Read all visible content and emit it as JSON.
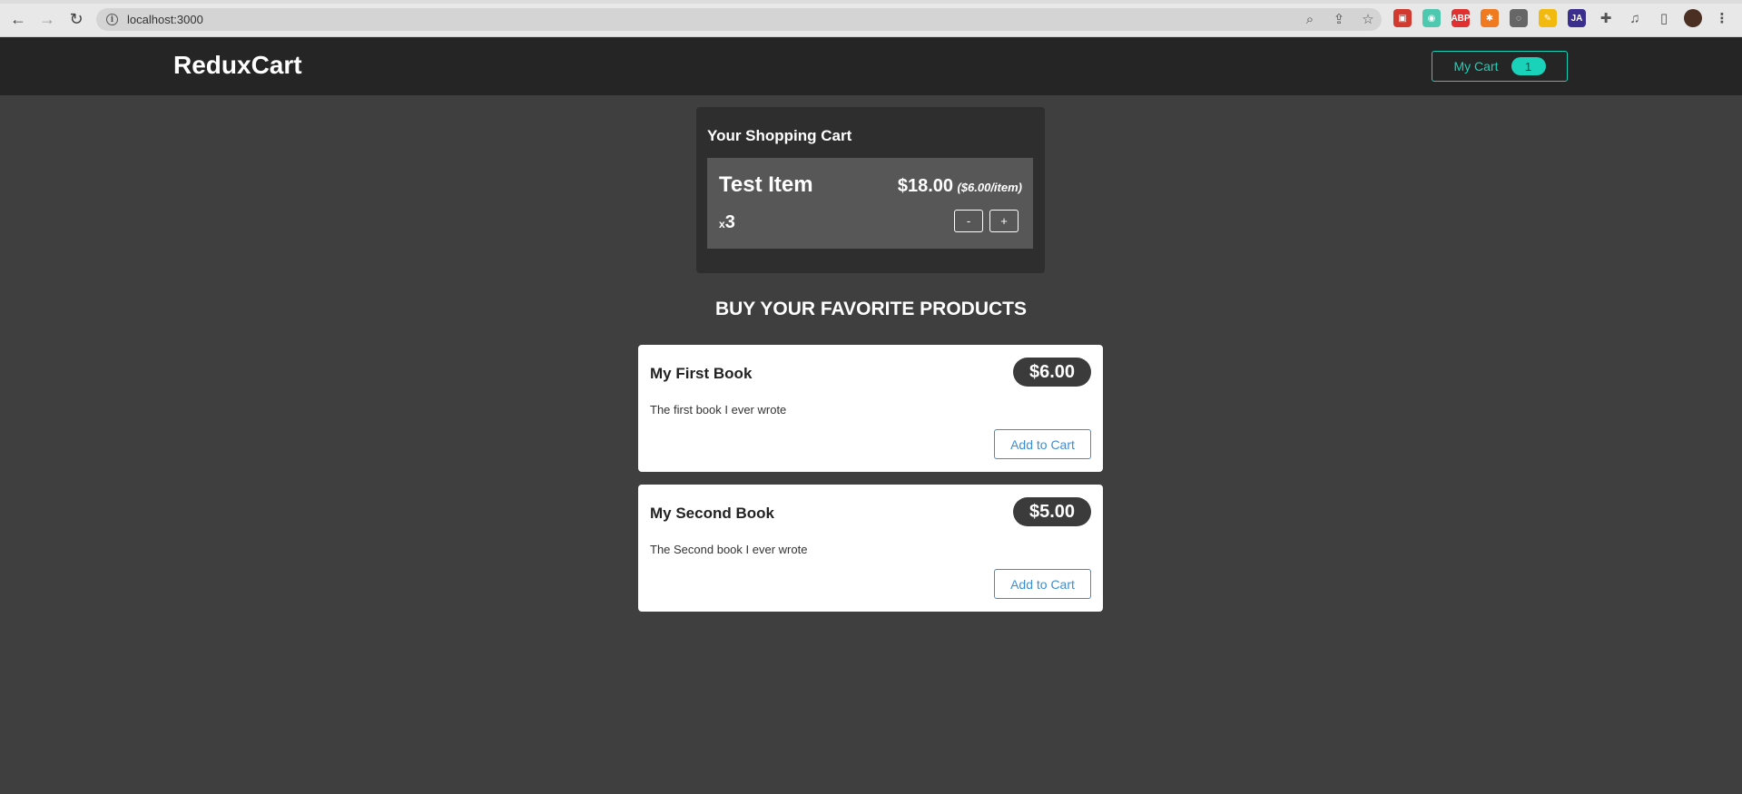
{
  "browser": {
    "url": "localhost:3000",
    "back_icon": "←",
    "forward_icon": "→",
    "reload_icon": "↻",
    "info_icon": "i",
    "zoom_icon": "⌕",
    "share_icon": "⇪",
    "star_icon": "☆",
    "extensions": [
      {
        "name": "ext-1",
        "glyph": "▣",
        "color": "#d23a2f"
      },
      {
        "name": "ext-2",
        "glyph": "◉",
        "color": "#4ec9b0"
      },
      {
        "name": "adblock",
        "glyph": "ABP",
        "color": "#e03030"
      },
      {
        "name": "ext-4",
        "glyph": "✱",
        "color": "#f07a20"
      },
      {
        "name": "ext-5",
        "glyph": "◌",
        "color": "#666666"
      },
      {
        "name": "ext-6",
        "glyph": "✎",
        "color": "#f2b90f"
      },
      {
        "name": "ext-7",
        "glyph": "JA",
        "color": "#3a2f8f"
      },
      {
        "name": "puzzle",
        "glyph": "✚",
        "color": "#555555"
      },
      {
        "name": "media",
        "glyph": "♫",
        "color": "#555555"
      },
      {
        "name": "sidebar",
        "glyph": "▯",
        "color": "#555555"
      },
      {
        "name": "profile",
        "glyph": "●",
        "color": "#4a2f22"
      },
      {
        "name": "menu",
        "glyph": "⋮",
        "color": "#555555"
      }
    ]
  },
  "header": {
    "brand": "ReduxCart",
    "cart_label": "My Cart",
    "cart_count": "1",
    "accent": "#1ad1b9"
  },
  "cart": {
    "title": "Your Shopping Cart",
    "item": {
      "name": "Test Item",
      "total": "$18.00",
      "unit_price": "($6.00/item)",
      "qty_prefix": "x",
      "qty": "3",
      "minus_label": "-",
      "plus_label": "+"
    }
  },
  "products": {
    "title": "BUY YOUR FAVORITE PRODUCTS",
    "items": [
      {
        "name": "My First Book",
        "price": "$6.00",
        "description": "The first book I ever wrote",
        "button": "Add to Cart"
      },
      {
        "name": "My Second Book",
        "price": "$5.00",
        "description": "The Second book I ever wrote",
        "button": "Add to Cart"
      }
    ]
  }
}
